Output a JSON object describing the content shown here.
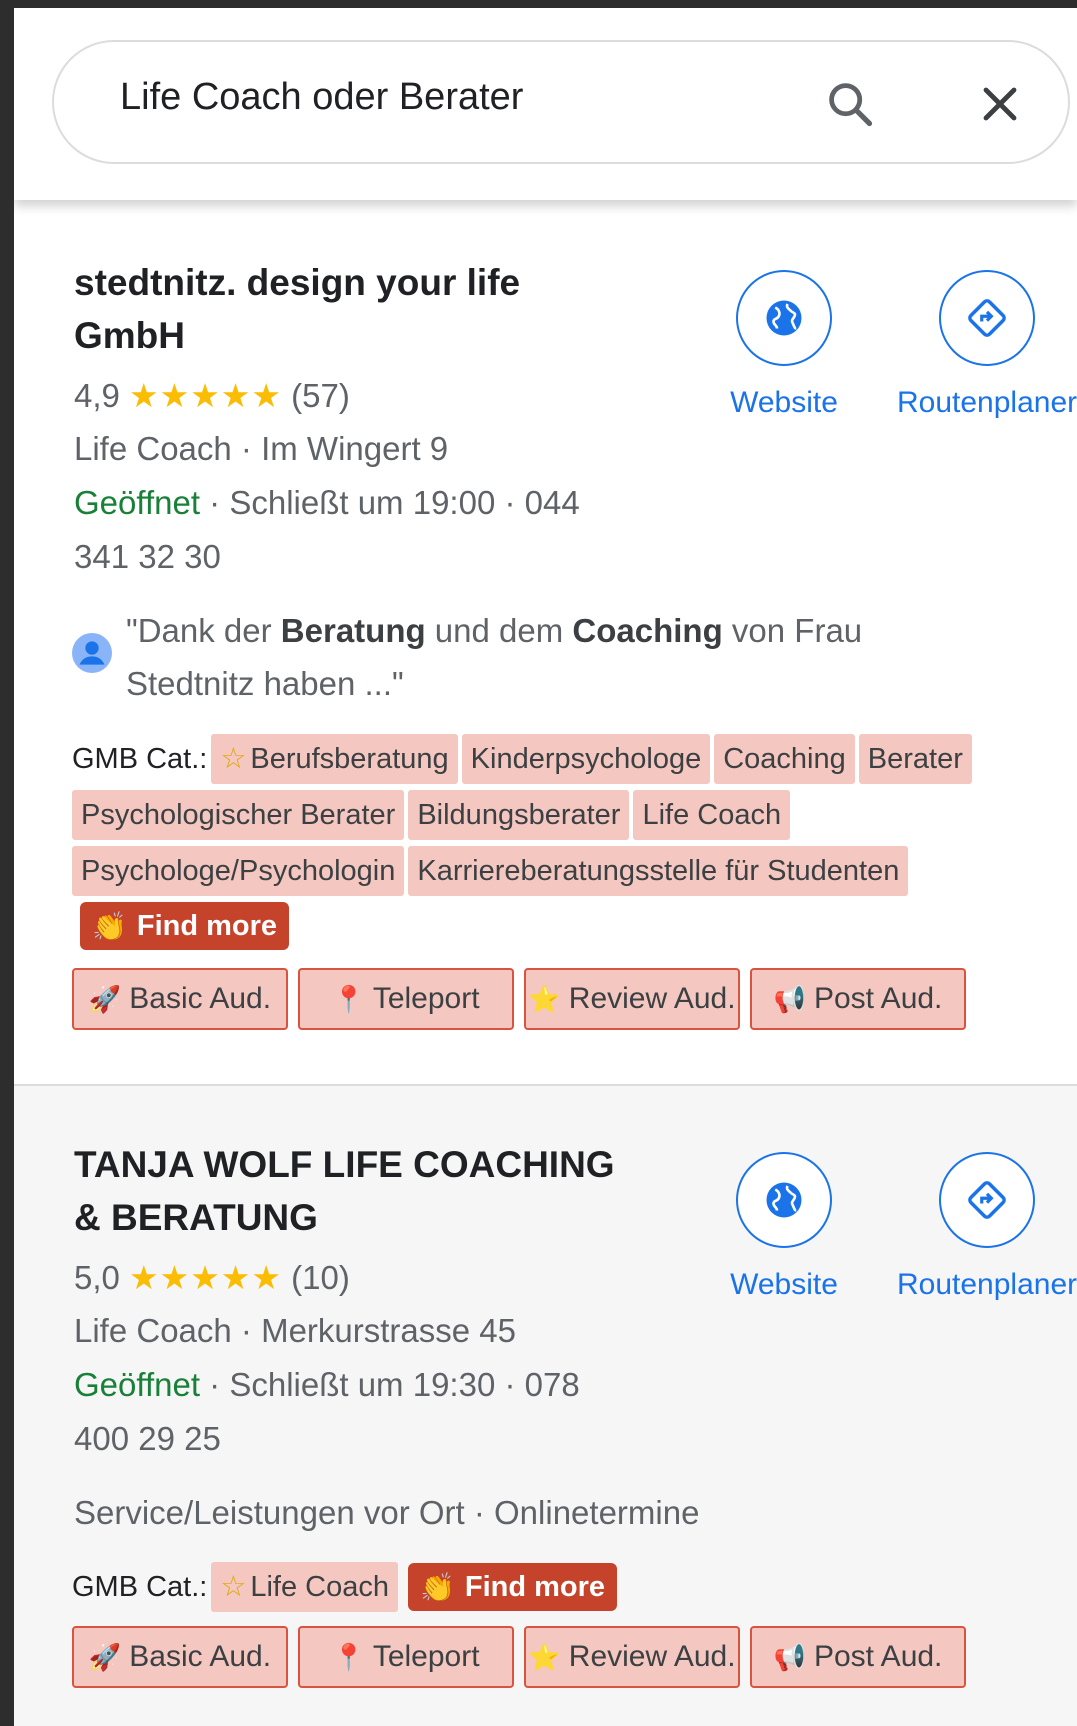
{
  "search": {
    "query": "Life Coach oder Berater"
  },
  "listings": [
    {
      "title": "stedtnitz. design your life GmbH",
      "rating": "4,9",
      "stars": "★★★★★",
      "reviews": "(57)",
      "category_address": "Life Coach · Im Wingert 9",
      "open": "Geöffnet",
      "hours_phone_1": " · Schließt um 19:00 · 044",
      "hours_phone_2": "341 32 30",
      "review_snippet": {
        "p1": "\"Dank der ",
        "b1": "Beratung",
        "p2": " und dem ",
        "b2": "Coaching",
        "p3": " von Frau Stedtnitz haben ...\""
      },
      "website_label": "Website",
      "route_label": "Routenplaner",
      "gmb_prefix": "GMB Cat.:",
      "primary_category": "Berufsberatung",
      "categories": [
        "Kinderpsychologe",
        "Coaching",
        "Berater",
        "Psychologischer Berater",
        "Bildungsberater",
        "Life Coach",
        "Psychologe/Psychologin",
        "Karriereberatungsstelle für Studenten"
      ],
      "find_more": "Find more",
      "buttons": [
        "Basic Aud.",
        "Teleport",
        "Review Aud.",
        "Post Aud."
      ]
    },
    {
      "title": "TANJA WOLF LIFE COACHING & BERATUNG",
      "rating": "5,0",
      "stars": "★★★★★",
      "reviews": "(10)",
      "category_address": "Life Coach · Merkurstrasse 45",
      "open": "Geöffnet",
      "hours_phone_1": " · Schließt um 19:30 · 078",
      "hours_phone_2": "400 29 25",
      "service": "Service/Leistungen vor Ort · Onlinetermine",
      "website_label": "Website",
      "route_label": "Routenplaner",
      "gmb_prefix": "GMB Cat.:",
      "primary_category": "Life Coach",
      "find_more": "Find more",
      "buttons": [
        "Basic Aud.",
        "Teleport",
        "Review Aud.",
        "Post Aud."
      ]
    }
  ],
  "colors": {
    "accent": "#1a73e8",
    "open": "#188038",
    "star": "#fbbc04",
    "chip": "#f4c7c0",
    "find_more": "#c5432b"
  }
}
